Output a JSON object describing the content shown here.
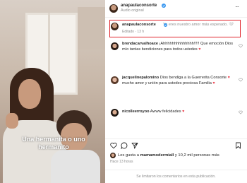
{
  "post": {
    "username": "anapaulaconsorte",
    "audio_label": "Audio original",
    "more_icon": "ellipsis-icon"
  },
  "video": {
    "caption": "Una hermanita o uno hermanito"
  },
  "comments": [
    {
      "username": "anapaulaconsorte",
      "text": "Ya eres nuestro amor más esperado. 🤍",
      "meta": "Editado · 13 h",
      "highlighted": true
    },
    {
      "username": "brendacarvalhoaxe",
      "text_line1": "¡Ahhhhhhhhhhhhhh!!!!! Que emoción Dios",
      "text_line2": "mío tantas bendiciones para todos ustedes"
    },
    {
      "username": "jacquelinepalomino",
      "text_line1": "Dios bendiga a la Guerrerita Consorte",
      "text_line2": "mucho amor y unión para ustedes preciosa Familia"
    },
    {
      "username": "nicolleerroyoo",
      "text": "Awww felicidades"
    }
  ],
  "likes": {
    "liked_by_prefix": "Les gusta a",
    "liked_by_user": "mamamodermiall",
    "liked_by_suffix": "y 10,2 mil personas más",
    "timestamp": "Hace 13 horas"
  },
  "footer_note": "Se limitaron los comentarios en esta publicación.",
  "colors": {
    "highlight_border": "#e0242b",
    "verified": "#3897f0",
    "heart": "#ed4956"
  }
}
